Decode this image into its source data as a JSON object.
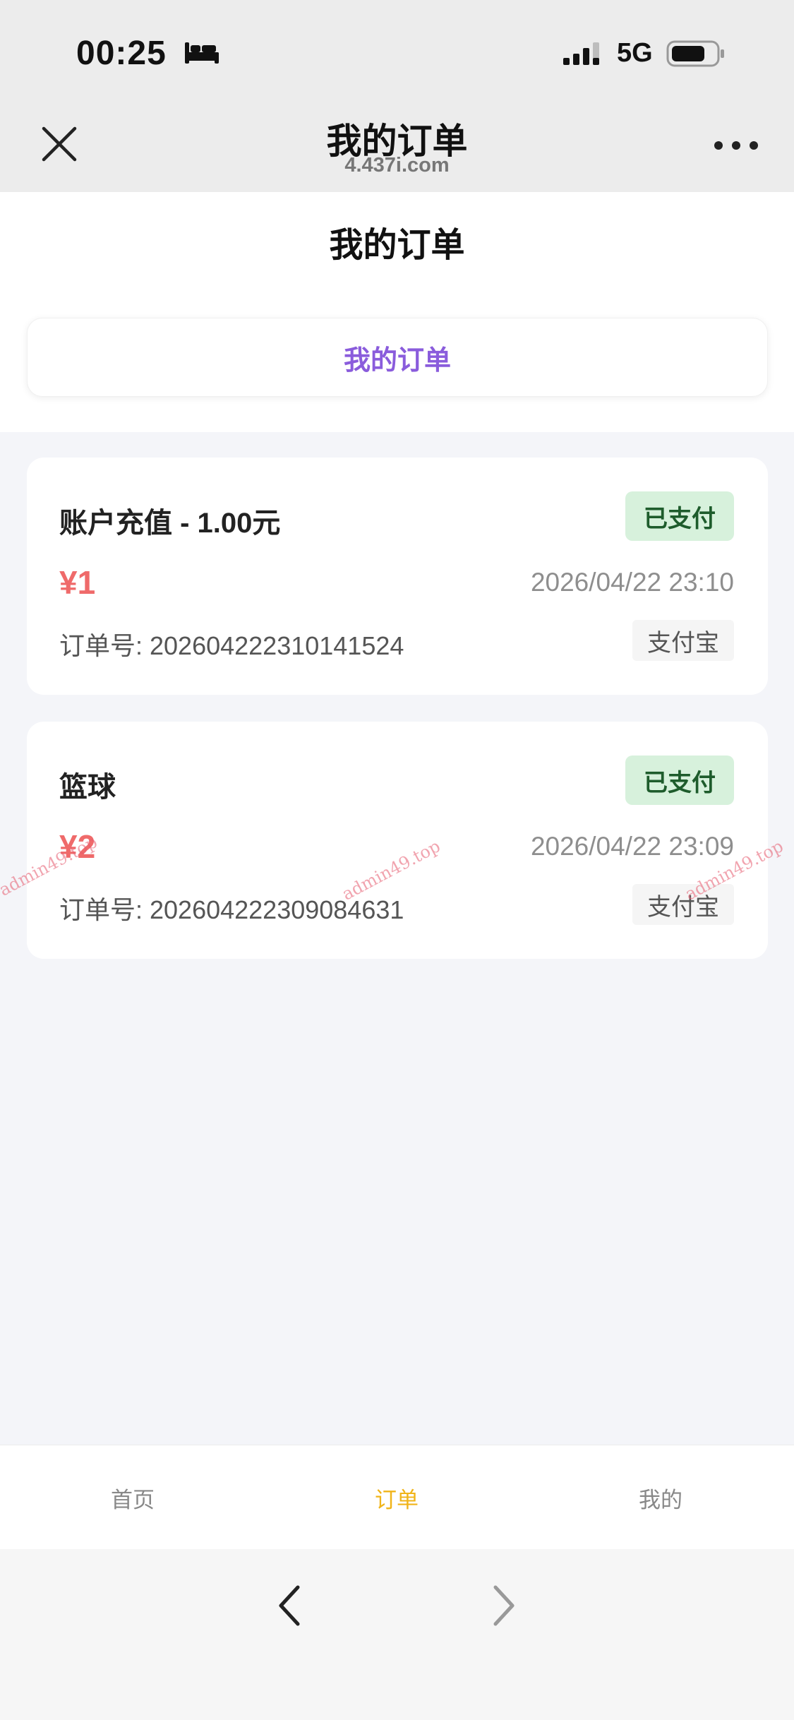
{
  "status_bar": {
    "time": "00:25",
    "network": "5G"
  },
  "browser": {
    "title": "我的订单",
    "url": "4.437i.com"
  },
  "page": {
    "title": "我的订单",
    "tab_label": "我的订单"
  },
  "orders": [
    {
      "title": "账户充值 - 1.00元",
      "status": "已支付",
      "price": "¥1",
      "time": "2026/04/22 23:10",
      "order_number": "订单号: 202604222310141524",
      "pay_method": "支付宝"
    },
    {
      "title": "篮球",
      "status": "已支付",
      "price": "¥2",
      "time": "2026/04/22 23:09",
      "order_number": "订单号: 202604222309084631",
      "pay_method": "支付宝"
    }
  ],
  "bottom_nav": {
    "items": [
      {
        "label": "首页",
        "active": false
      },
      {
        "label": "订单",
        "active": true
      },
      {
        "label": "我的",
        "active": false
      }
    ]
  },
  "watermark": "admin49.top",
  "colors": {
    "accent_purple": "#8a5cdc",
    "price_red": "#ef6a6a",
    "badge_green_bg": "#d7f1dc",
    "badge_green_text": "#1e5c2c",
    "nav_active": "#f0b419"
  }
}
